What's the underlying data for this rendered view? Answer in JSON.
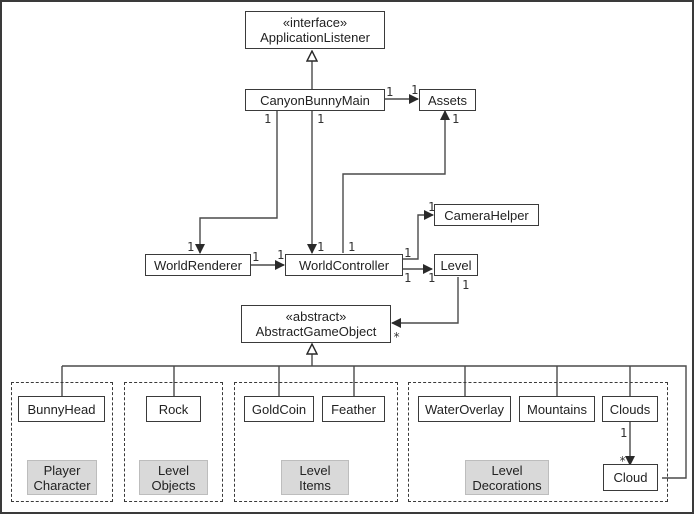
{
  "classes": {
    "application_listener": {
      "stereotype": "«interface»",
      "name": "ApplicationListener"
    },
    "canyon_bunny_main": {
      "name": "CanyonBunnyMain"
    },
    "assets": {
      "name": "Assets"
    },
    "camera_helper": {
      "name": "CameraHelper"
    },
    "world_renderer": {
      "name": "WorldRenderer"
    },
    "world_controller": {
      "name": "WorldController"
    },
    "level": {
      "name": "Level"
    },
    "abstract_game_object": {
      "stereotype": "«abstract»",
      "name": "AbstractGameObject"
    },
    "bunny_head": {
      "name": "BunnyHead"
    },
    "rock": {
      "name": "Rock"
    },
    "gold_coin": {
      "name": "GoldCoin"
    },
    "feather": {
      "name": "Feather"
    },
    "water_overlay": {
      "name": "WaterOverlay"
    },
    "mountains": {
      "name": "Mountains"
    },
    "clouds": {
      "name": "Clouds"
    },
    "cloud": {
      "name": "Cloud"
    }
  },
  "groups": {
    "player_character": {
      "line1": "Player",
      "line2": "Character"
    },
    "level_objects": {
      "line1": "Level",
      "line2": "Objects"
    },
    "level_items": {
      "line1": "Level",
      "line2": "Items"
    },
    "level_decorations": {
      "line1": "Level",
      "line2": "Decorations"
    }
  },
  "multiplicities": {
    "main_assets_src": "1",
    "main_assets_dst": "1",
    "main_renderer_src": "1",
    "main_controller_src": "1",
    "controller_assets_dst": "1",
    "renderer_from_main": "1",
    "controller_from_main": "1",
    "controller_to_assets_src": "1",
    "renderer_controller_src": "1",
    "renderer_controller_dst": "1",
    "controller_camera_src": "1",
    "controller_camera_dst": "1",
    "controller_level_src": "1",
    "controller_level_dst": "1",
    "level_ago_src": "1",
    "level_ago_dst": "*",
    "clouds_cloud_src": "1",
    "clouds_cloud_dst": "*"
  },
  "colors": {
    "line": "#3a3a3a",
    "tag_bg": "#d9d9d9"
  }
}
